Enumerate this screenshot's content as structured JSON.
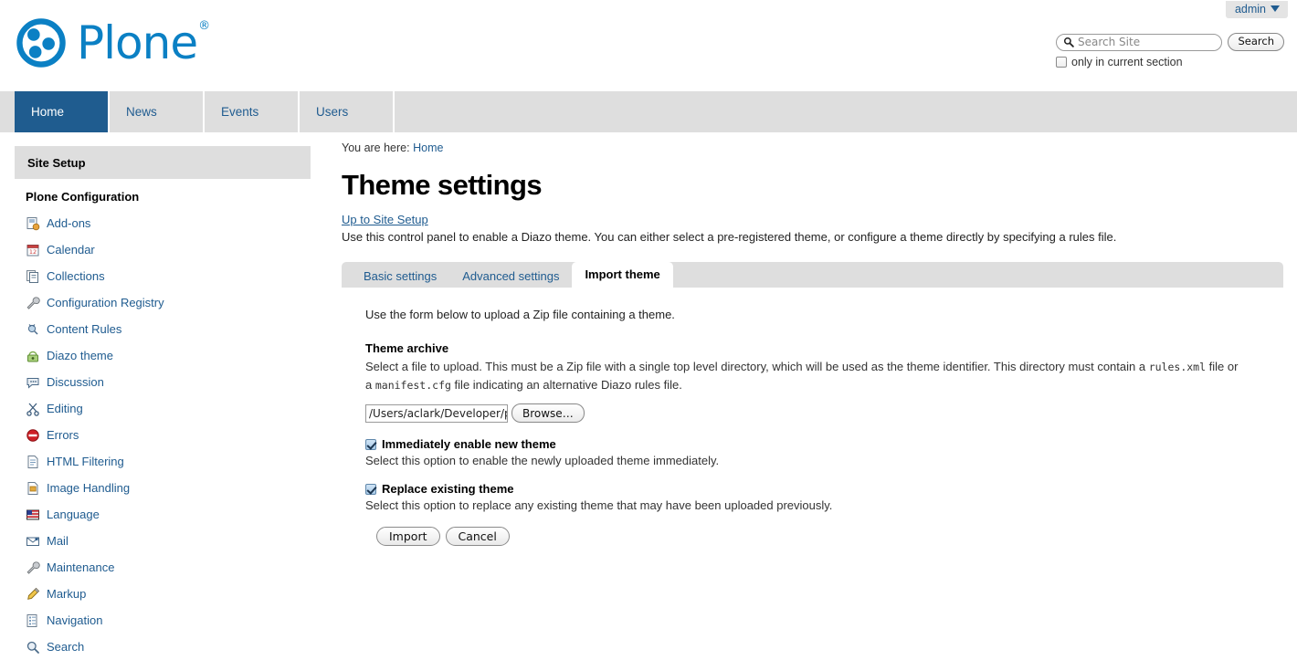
{
  "personal_bar": {
    "user_label": "admin",
    "caret_icon": "chevron-down-icon"
  },
  "header": {
    "logo_text": "Plone",
    "logo_registered": "®",
    "logo_icon": "plone-logo-icon"
  },
  "search": {
    "placeholder": "Search Site",
    "value": "",
    "button_label": "Search",
    "magnifier_icon": "search-icon",
    "current_section_label": "only in current section",
    "current_section_checked": false
  },
  "global_nav": {
    "items": [
      {
        "label": "Home",
        "selected": true
      },
      {
        "label": "News",
        "selected": false
      },
      {
        "label": "Events",
        "selected": false
      },
      {
        "label": "Users",
        "selected": false
      }
    ]
  },
  "sidebar": {
    "portlet_title": "Site Setup",
    "group_title": "Plone Configuration",
    "items": [
      {
        "label": "Add-ons",
        "icon": "addons-icon"
      },
      {
        "label": "Calendar",
        "icon": "calendar-icon"
      },
      {
        "label": "Collections",
        "icon": "collections-icon"
      },
      {
        "label": "Configuration Registry",
        "icon": "wrench-icon"
      },
      {
        "label": "Content Rules",
        "icon": "content-rules-icon"
      },
      {
        "label": "Diazo theme",
        "icon": "diazo-theme-icon"
      },
      {
        "label": "Discussion",
        "icon": "discussion-icon"
      },
      {
        "label": "Editing",
        "icon": "scissors-icon"
      },
      {
        "label": "Errors",
        "icon": "error-icon"
      },
      {
        "label": "HTML Filtering",
        "icon": "document-icon"
      },
      {
        "label": "Image Handling",
        "icon": "image-document-icon"
      },
      {
        "label": "Language",
        "icon": "flag-icon"
      },
      {
        "label": "Mail",
        "icon": "envelope-icon"
      },
      {
        "label": "Maintenance",
        "icon": "wrench-icon"
      },
      {
        "label": "Markup",
        "icon": "pencil-icon"
      },
      {
        "label": "Navigation",
        "icon": "navigation-icon"
      },
      {
        "label": "Search",
        "icon": "search-icon"
      }
    ]
  },
  "main": {
    "breadcrumb_prefix": "You are here:",
    "breadcrumb_home": "Home",
    "title": "Theme settings",
    "up_link": "Up to Site Setup",
    "description": "Use this control panel to enable a Diazo theme. You can either select a pre-registered theme, or configure a theme directly by specifying a rules file.",
    "tabs": [
      {
        "label": "Basic settings",
        "active": false
      },
      {
        "label": "Advanced settings",
        "active": false
      },
      {
        "label": "Import theme",
        "active": true
      }
    ]
  },
  "form": {
    "lead": "Use the form below to upload a Zip file containing a theme.",
    "archive": {
      "label": "Theme archive",
      "help_part1": "Select a file to upload. This must be a Zip file with a single top level directory, which will be used as the theme identifier. This directory must contain a ",
      "help_code1": "rules.xml",
      "help_part2": " file or a ",
      "help_code2": "manifest.cfg",
      "help_part3": " file indicating an alternative Diazo rules file.",
      "file_value": "/Users/aclark/Developer/pl",
      "browse_label": "Browse…"
    },
    "enable": {
      "label": "Immediately enable new theme",
      "help": "Select this option to enable the newly uploaded theme immediately.",
      "checked": true
    },
    "replace": {
      "label": "Replace existing theme",
      "help": "Select this option to replace any existing theme that may have been uploaded previously.",
      "checked": true
    },
    "submit_label": "Import",
    "cancel_label": "Cancel"
  },
  "colors": {
    "plone_blue": "#0b80c4",
    "link_blue": "#205c90",
    "nav_active": "#1f5c8f",
    "gray_bar": "#dedede"
  }
}
